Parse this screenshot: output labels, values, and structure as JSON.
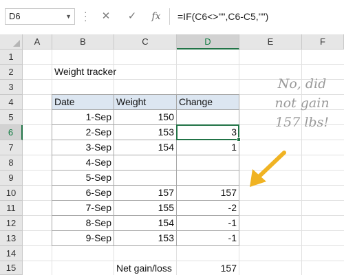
{
  "formula_bar": {
    "name_box": "D6",
    "cancel_icon": "✕",
    "enter_icon": "✓",
    "fx_label": "fx",
    "formula": "=IF(C6<>\"\",C6-C5,\"\")"
  },
  "columns": [
    "A",
    "B",
    "C",
    "D",
    "E",
    "F"
  ],
  "rows": [
    "1",
    "2",
    "3",
    "4",
    "5",
    "6",
    "7",
    "8",
    "9",
    "10",
    "11",
    "12",
    "13",
    "14",
    "15"
  ],
  "selected_cell": "D6",
  "sheet": {
    "title": "Weight tracker",
    "table_headers": [
      "Date",
      "Weight",
      "Change"
    ],
    "table_rows": [
      [
        "1-Sep",
        "150",
        ""
      ],
      [
        "2-Sep",
        "153",
        "3"
      ],
      [
        "3-Sep",
        "154",
        "1"
      ],
      [
        "4-Sep",
        "",
        ""
      ],
      [
        "5-Sep",
        "",
        ""
      ],
      [
        "6-Sep",
        "157",
        "157"
      ],
      [
        "7-Sep",
        "155",
        "-2"
      ],
      [
        "8-Sep",
        "154",
        "-1"
      ],
      [
        "9-Sep",
        "153",
        "-1"
      ]
    ],
    "summary_label": "Net gain/loss",
    "summary_value": "157"
  },
  "annotation": {
    "line1": "No, did",
    "line2": "not gain",
    "line3": "157 lbs!",
    "arrow_color": "#f0b323",
    "text_color": "#9a9a9a"
  },
  "colors": {
    "accent": "#217346",
    "header_fill": "#dce6f1"
  }
}
